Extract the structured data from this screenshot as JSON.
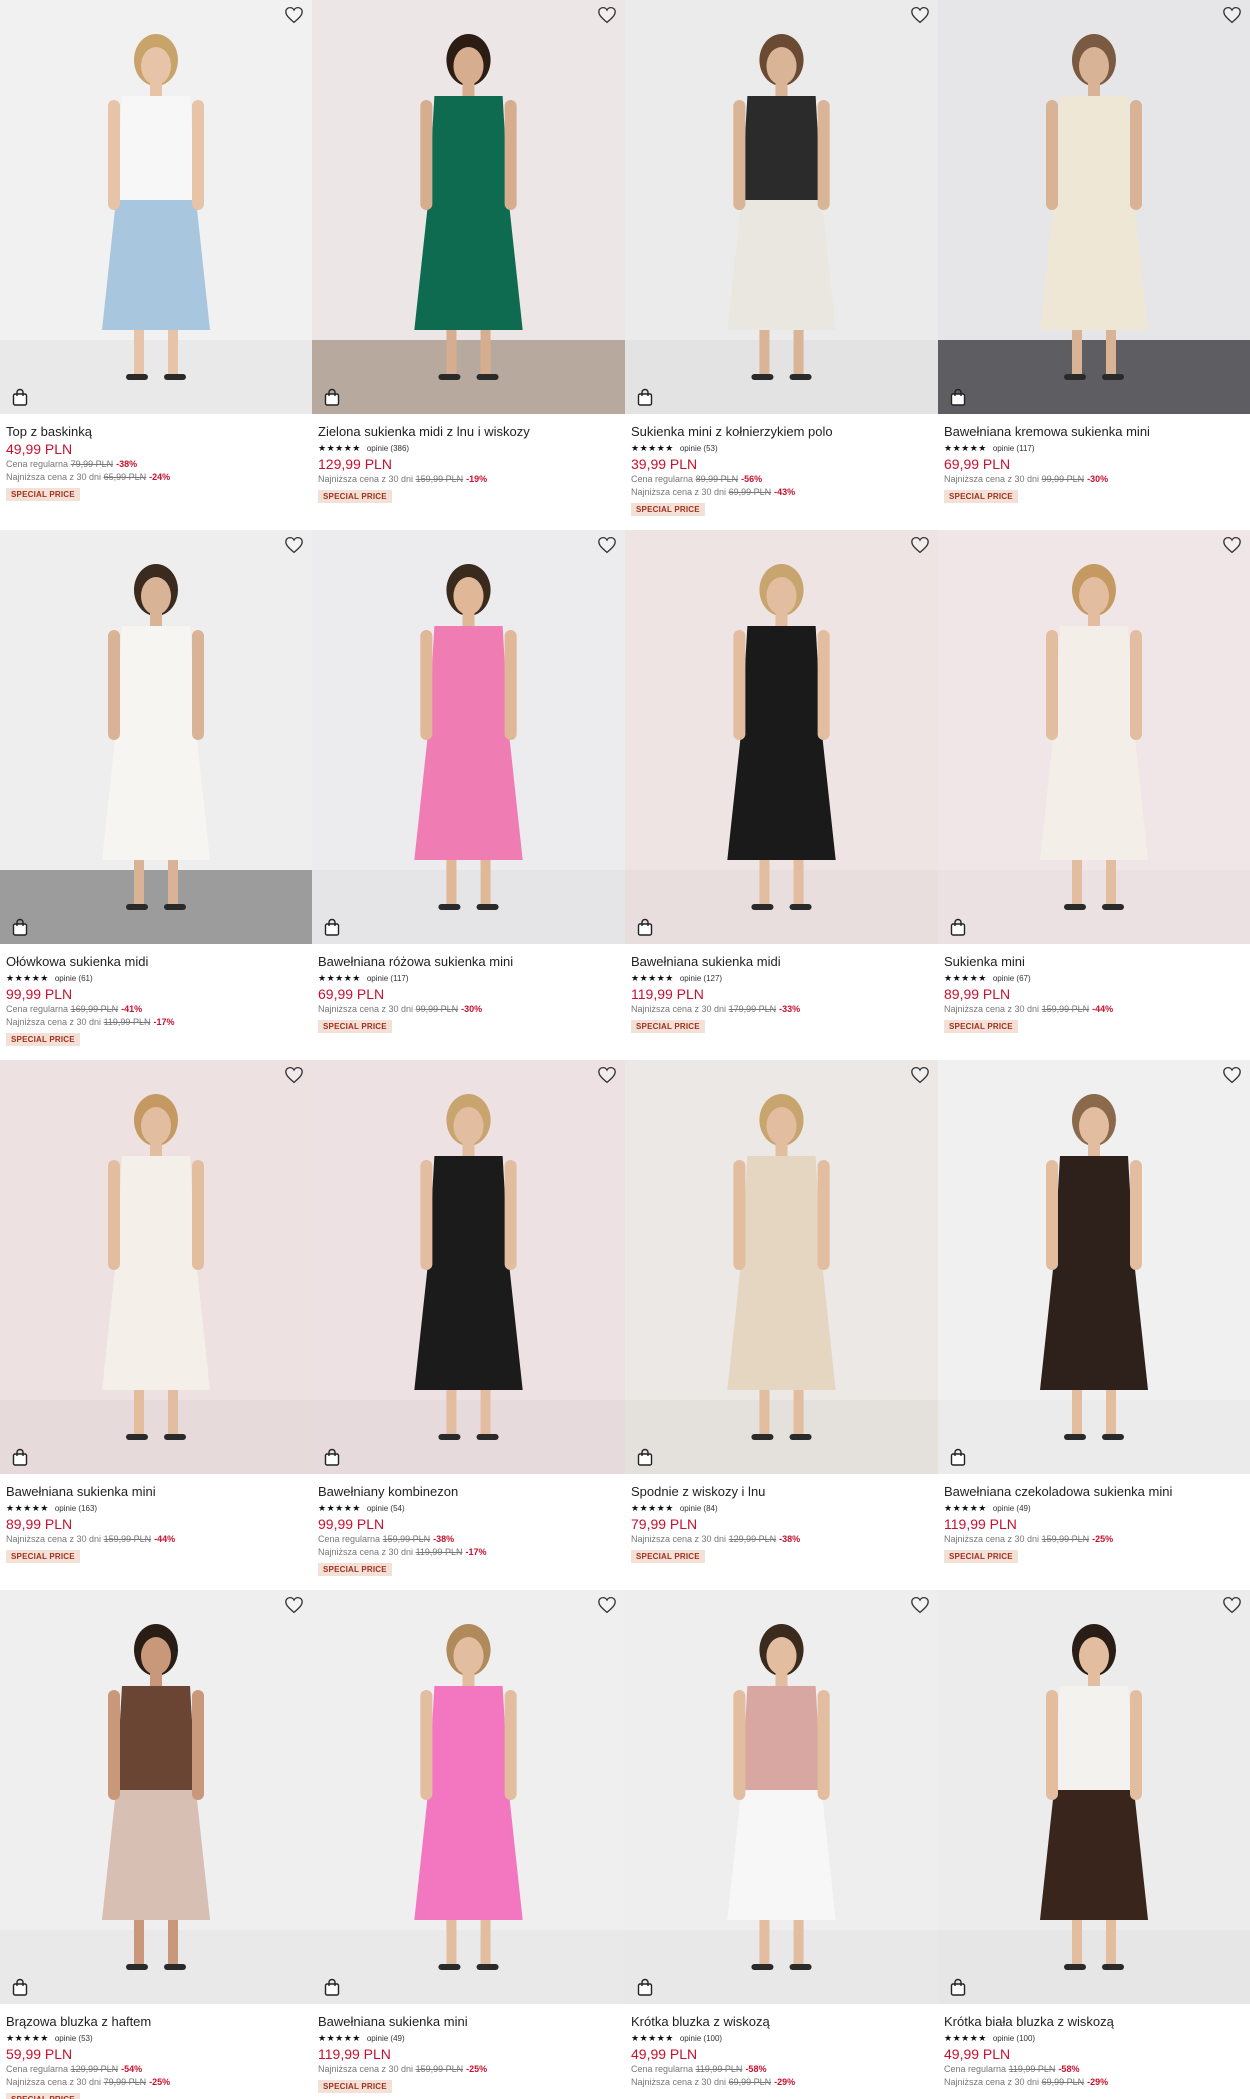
{
  "colors": {
    "price": "#c8102e",
    "badge_bg": "#f3e1d8",
    "badge_text": "#a3301c"
  },
  "icons": {
    "wishlist": "heart-outline-icon",
    "cart": "shopping-bag-icon"
  },
  "products": [
    {
      "name": "Top z baskinką",
      "reviews": "",
      "price": "49,99 PLN",
      "lines": [
        {
          "label": "Cena regularna",
          "old": "79,99 PLN",
          "disc": "-38%"
        },
        {
          "label": "Najniższa cena z 30 dni",
          "old": "65,99 PLN",
          "disc": "-24%"
        }
      ],
      "badge": "SPECIAL PRICE",
      "colors": {
        "bg": "#f1f1f2",
        "floor": "#e9e9ea",
        "main": "#a9c6df",
        "top": "#f7f7f7",
        "skin": "#e7c3a7",
        "hair": "#c9a46a"
      }
    },
    {
      "name": "Zielona sukienka midi z lnu i wiskozy",
      "reviews": "opinie (386)",
      "price": "129,99 PLN",
      "lines": [
        {
          "label": "Najniższa cena z 30 dni",
          "old": "159,99 PLN",
          "disc": "-19%"
        }
      ],
      "badge": "SPECIAL PRICE",
      "colors": {
        "bg": "#ede6e6",
        "floor": "#b8a99e",
        "main": "#0e6b4f",
        "top": "#0e6b4f",
        "skin": "#d6ad8e",
        "hair": "#2b1d14"
      }
    },
    {
      "name": "Sukienka mini z kołnierzykiem polo",
      "reviews": "opinie (53)",
      "price": "39,99 PLN",
      "lines": [
        {
          "label": "Cena regularna",
          "old": "89,99 PLN",
          "disc": "-56%"
        },
        {
          "label": "Najniższa cena z 30 dni",
          "old": "69,99 PLN",
          "disc": "-43%"
        }
      ],
      "badge": "SPECIAL PRICE",
      "colors": {
        "bg": "#ebebeb",
        "floor": "#e3e3e3",
        "main": "#e9e7df",
        "top": "#2b2b2b",
        "skin": "#d9b497",
        "hair": "#6a4a32"
      }
    },
    {
      "name": "Bawełniana kremowa sukienka mini",
      "reviews": "opinie (117)",
      "price": "69,99 PLN",
      "lines": [
        {
          "label": "Najniższa cena z 30 dni",
          "old": "99,99 PLN",
          "disc": "-30%"
        }
      ],
      "badge": "SPECIAL PRICE",
      "colors": {
        "bg": "#e6e6e8",
        "floor": "#5e5e62",
        "main": "#eee7d6",
        "top": "#eee7d6",
        "skin": "#d8b396",
        "hair": "#7a5a40"
      }
    },
    {
      "name": "Ołówkowa sukienka midi",
      "reviews": "opinie (61)",
      "price": "99,99 PLN",
      "lines": [
        {
          "label": "Cena regularna",
          "old": "169,99 PLN",
          "disc": "-41%"
        },
        {
          "label": "Najniższa cena z 30 dni",
          "old": "119,99 PLN",
          "disc": "-17%"
        }
      ],
      "badge": "SPECIAL PRICE",
      "colors": {
        "bg": "#eeeeee",
        "floor": "#9c9c9c",
        "main": "#f6f5f1",
        "top": "#f6f5f1",
        "skin": "#d8b396",
        "hair": "#3b2a1e"
      }
    },
    {
      "name": "Bawełniana różowa sukienka mini",
      "reviews": "opinie (117)",
      "price": "69,99 PLN",
      "lines": [
        {
          "label": "Najniższa cena z 30 dni",
          "old": "99,99 PLN",
          "disc": "-30%"
        }
      ],
      "badge": "SPECIAL PRICE",
      "colors": {
        "bg": "#ececee",
        "floor": "#e5e5e7",
        "main": "#f07cb4",
        "top": "#f07cb4",
        "skin": "#e0b898",
        "hair": "#3a2a1e"
      }
    },
    {
      "name": "Bawełniana sukienka midi",
      "reviews": "opinie (127)",
      "price": "119,99 PLN",
      "lines": [
        {
          "label": "Najniższa cena z 30 dni",
          "old": "179,99 PLN",
          "disc": "-33%"
        }
      ],
      "badge": "SPECIAL PRICE",
      "colors": {
        "bg": "#efe4e4",
        "floor": "#e8dede",
        "main": "#1a1a1a",
        "top": "#1a1a1a",
        "skin": "#e3bda0",
        "hair": "#c8a46e"
      }
    },
    {
      "name": "Sukienka mini",
      "reviews": "opinie (67)",
      "price": "89,99 PLN",
      "lines": [
        {
          "label": "Najniższa cena z 30 dni",
          "old": "159,99 PLN",
          "disc": "-44%"
        }
      ],
      "badge": "SPECIAL PRICE",
      "colors": {
        "bg": "#f0e6e8",
        "floor": "#ebe1e3",
        "main": "#f3eee8",
        "top": "#f3eee8",
        "skin": "#e3bda0",
        "hair": "#c49a62"
      }
    },
    {
      "name": "Bawełniana sukienka mini",
      "reviews": "opinie (163)",
      "price": "89,99 PLN",
      "lines": [
        {
          "label": "Najniższa cena z 30 dni",
          "old": "159,99 PLN",
          "disc": "-44%"
        }
      ],
      "badge": "SPECIAL PRICE",
      "colors": {
        "bg": "#ede1e1",
        "floor": "#e6dada",
        "main": "#f4efe8",
        "top": "#f4efe8",
        "skin": "#e3bda0",
        "hair": "#c49a62"
      }
    },
    {
      "name": "Bawełniany kombinezon",
      "reviews": "opinie (54)",
      "price": "99,99 PLN",
      "lines": [
        {
          "label": "Cena regularna",
          "old": "159,99 PLN",
          "disc": "-38%"
        },
        {
          "label": "Najniższa cena z 30 dni",
          "old": "119,99 PLN",
          "disc": "-17%"
        }
      ],
      "badge": "SPECIAL PRICE",
      "colors": {
        "bg": "#ede1e3",
        "floor": "#e6dadc",
        "main": "#1b1b1b",
        "top": "#1b1b1b",
        "skin": "#e3bda0",
        "hair": "#c8a46e"
      }
    },
    {
      "name": "Spodnie z wiskozy i lnu",
      "reviews": "opinie (84)",
      "price": "79,99 PLN",
      "lines": [
        {
          "label": "Najniższa cena z 30 dni",
          "old": "129,99 PLN",
          "disc": "-38%"
        }
      ],
      "badge": "SPECIAL PRICE",
      "colors": {
        "bg": "#ebe8e5",
        "floor": "#e4e1dd",
        "main": "#e4d6c0",
        "top": "#e4d6c0",
        "skin": "#e3bda0",
        "hair": "#c8a46e"
      }
    },
    {
      "name": "Bawełniana czekoladowa sukienka mini",
      "reviews": "opinie (49)",
      "price": "119,99 PLN",
      "lines": [
        {
          "label": "Najniższa cena z 30 dni",
          "old": "159,99 PLN",
          "disc": "-25%"
        }
      ],
      "badge": "SPECIAL PRICE",
      "colors": {
        "bg": "#f0f0f0",
        "floor": "#ebebeb",
        "main": "#2e211b",
        "top": "#2e211b",
        "skin": "#e3bda0",
        "hair": "#8a6a4a"
      }
    },
    {
      "name": "Brązowa bluzka z haftem",
      "reviews": "opinie (53)",
      "price": "59,99 PLN",
      "lines": [
        {
          "label": "Cena regularna",
          "old": "129,99 PLN",
          "disc": "-54%"
        },
        {
          "label": "Najniższa cena z 30 dni",
          "old": "79,99 PLN",
          "disc": "-25%"
        }
      ],
      "badge": "SPECIAL PRICE",
      "colors": {
        "bg": "#efefef",
        "floor": "#e9e9e9",
        "main": "#d8bfb3",
        "top": "#6b4533",
        "skin": "#c9987a",
        "hair": "#2a1d15"
      }
    },
    {
      "name": "Bawełniana sukienka mini",
      "reviews": "opinie (49)",
      "price": "119,99 PLN",
      "lines": [
        {
          "label": "Najniższa cena z 30 dni",
          "old": "159,99 PLN",
          "disc": "-25%"
        }
      ],
      "badge": "SPECIAL PRICE",
      "colors": {
        "bg": "#efefef",
        "floor": "#e9e9e9",
        "main": "#f277c0",
        "top": "#f277c0",
        "skin": "#e3bda0",
        "hair": "#b08a5a"
      }
    },
    {
      "name": "Krótka bluzka z wiskozą",
      "reviews": "opinie (100)",
      "price": "49,99 PLN",
      "lines": [
        {
          "label": "Cena regularna",
          "old": "119,99 PLN",
          "disc": "-58%"
        },
        {
          "label": "Najniższa cena z 30 dni",
          "old": "69,99 PLN",
          "disc": "-29%"
        }
      ],
      "badge": "",
      "colors": {
        "bg": "#eeeeee",
        "floor": "#e8e8e8",
        "main": "#f7f7f7",
        "top": "#d8a7a2",
        "skin": "#e3bda0",
        "hair": "#3b2a1e"
      }
    },
    {
      "name": "Krótka biała bluzka z wiskozą",
      "reviews": "opinie (100)",
      "price": "49,99 PLN",
      "lines": [
        {
          "label": "Cena regularna",
          "old": "119,99 PLN",
          "disc": "-58%"
        },
        {
          "label": "Najniższa cena z 30 dni",
          "old": "69,99 PLN",
          "disc": "-29%"
        }
      ],
      "badge": "",
      "colors": {
        "bg": "#ececec",
        "floor": "#e6e6e6",
        "main": "#3a251c",
        "top": "#f4f2ee",
        "skin": "#e3bda0",
        "hair": "#2a1d15"
      }
    }
  ]
}
